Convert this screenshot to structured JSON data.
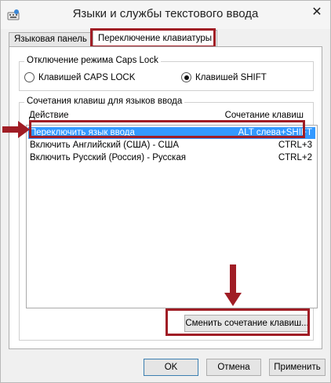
{
  "window": {
    "title": "Языки и службы текстового ввода",
    "close_glyph": "✕"
  },
  "tabs": [
    {
      "label": "Языковая панель",
      "active": false
    },
    {
      "label": "Переключение клавиатуры",
      "active": true
    }
  ],
  "caps_lock_group": {
    "caption": "Отключение режима Caps Lock",
    "options": [
      {
        "label": "Клавишей CAPS LOCK",
        "selected": false
      },
      {
        "label": "Клавишей SHIFT",
        "selected": true
      }
    ]
  },
  "hotkeys_group": {
    "caption": "Сочетания клавиш для языков ввода",
    "columns": {
      "action": "Действие",
      "shortcut": "Сочетание клавиш"
    },
    "rows": [
      {
        "action": "Переключить язык ввода",
        "shortcut": "ALT слева+SHIFT",
        "selected": true
      },
      {
        "action": "Включить Английский (США) - США",
        "shortcut": "CTRL+3",
        "selected": false
      },
      {
        "action": "Включить Русский (Россия) - Русская",
        "shortcut": "CTRL+2",
        "selected": false
      }
    ],
    "change_button": "Сменить сочетание клавиш..."
  },
  "footer": {
    "ok": "OK",
    "cancel": "Отмена",
    "apply": "Применить"
  },
  "colors": {
    "highlight": "#a01d25",
    "selection": "#3399ff",
    "window_bg": "#f0f0f0"
  },
  "icons": {
    "app": "keyboard-language-icon",
    "close": "close-icon",
    "arrow_right": "arrow-right-icon",
    "arrow_down": "arrow-down-icon"
  }
}
